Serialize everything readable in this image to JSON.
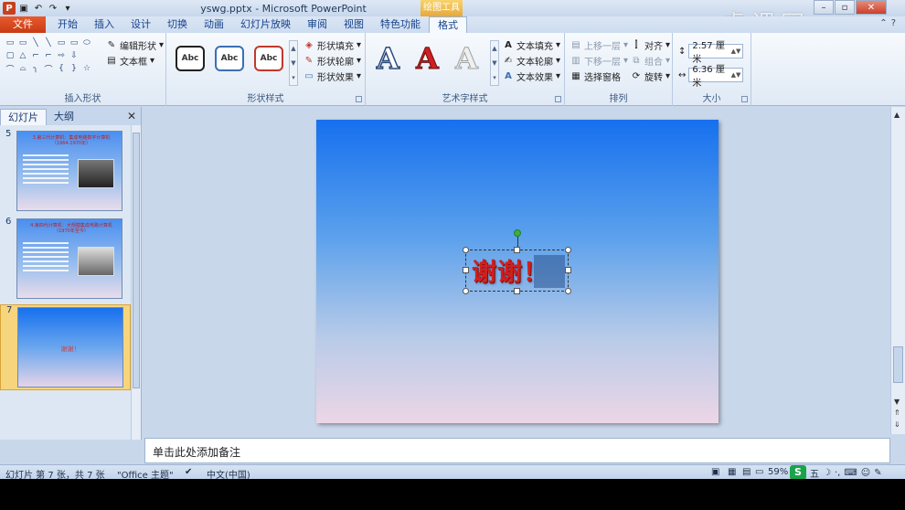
{
  "window": {
    "title": "yswg.pptx - Microsoft PowerPoint",
    "contextual_tab_header": "绘图工具",
    "watermark": "虎课网"
  },
  "tabs": [
    {
      "label": "文件",
      "kind": "file"
    },
    {
      "label": "开始"
    },
    {
      "label": "插入"
    },
    {
      "label": "设计"
    },
    {
      "label": "切换"
    },
    {
      "label": "动画"
    },
    {
      "label": "幻灯片放映"
    },
    {
      "label": "审阅"
    },
    {
      "label": "视图"
    },
    {
      "label": "特色功能"
    },
    {
      "label": "格式",
      "active": true
    }
  ],
  "ribbon": {
    "insert_shapes": {
      "label": "插入形状",
      "edit_shape": "编辑形状",
      "text_box": "文本框",
      "shape_glyphs": [
        "▭",
        "▭",
        "╲",
        "╲",
        "▭",
        "▭",
        "⬭",
        "",
        "",
        "▢",
        "△",
        "⌐",
        "⌐",
        "⇨",
        "⇩",
        "",
        "",
        "",
        "⌒",
        "⌓",
        "╮",
        "⌒",
        "{",
        "}",
        "☆",
        "",
        ""
      ]
    },
    "shape_styles": {
      "label": "形状样式",
      "sample": "Abc",
      "fill": "形状填充",
      "outline": "形状轮廓",
      "effects": "形状效果"
    },
    "wordart": {
      "label": "艺术字样式",
      "sample": "A",
      "text_fill": "文本填充",
      "text_outline": "文本轮廓",
      "text_effects": "文本效果"
    },
    "arrange": {
      "label": "排列",
      "bring_forward": "上移一层",
      "send_backward": "下移一层",
      "selection_pane": "选择窗格",
      "align": "对齐",
      "group": "组合",
      "rotate": "旋转"
    },
    "size": {
      "label": "大小",
      "height": "2.57 厘米",
      "width": "6.36 厘米"
    }
  },
  "left_panel": {
    "tabs": [
      "幻灯片",
      "大纲"
    ],
    "close_glyph": "✕",
    "slides": [
      {
        "number": "5",
        "title": "3.第三代计算机：集成电路数字计算机（1964-1970年）"
      },
      {
        "number": "6",
        "title": "4.第四代计算机：大规模集成电路计算机（1970年至今）"
      },
      {
        "number": "7",
        "text": "谢谢！",
        "selected": true
      }
    ]
  },
  "slide": {
    "text": "谢谢！"
  },
  "notes": {
    "placeholder": "单击此处添加备注"
  },
  "status": {
    "slide_info": "幻灯片 第 7 张，共 7 张",
    "theme": "\"Office 主题\"",
    "language": "中文(中国)",
    "zoom": "59%",
    "ime_label": "五"
  },
  "colors": {
    "file_tab": "#d2431a",
    "wordart_red": "#d11f1f",
    "slide_top": "#1670ee",
    "slide_bottom": "#ecd6e6"
  }
}
